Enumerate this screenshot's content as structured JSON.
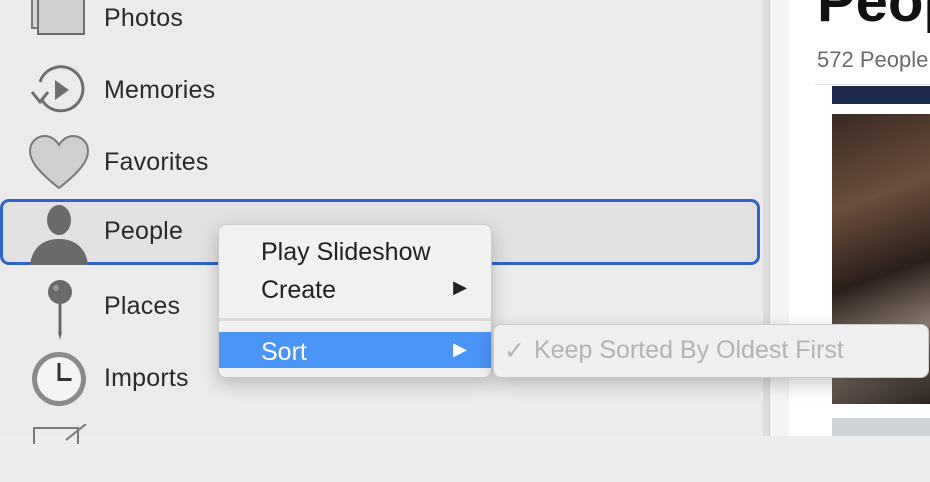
{
  "sidebar": {
    "items": [
      {
        "label": "Photos",
        "icon": "photos-icon"
      },
      {
        "label": "Memories",
        "icon": "memories-icon"
      },
      {
        "label": "Favorites",
        "icon": "heart-icon"
      },
      {
        "label": "People",
        "icon": "person-icon",
        "selected": true
      },
      {
        "label": "Places",
        "icon": "pin-icon"
      },
      {
        "label": "Imports",
        "icon": "clock-icon"
      }
    ]
  },
  "main": {
    "title": "People",
    "count": "572 People"
  },
  "context_menu": {
    "items": [
      {
        "label": "Play Slideshow"
      },
      {
        "label": "Create",
        "arrow": "▶"
      },
      {
        "label": "Sort",
        "arrow": "▶",
        "highlighted": true
      }
    ]
  },
  "submenu": {
    "check": "✓",
    "label": "Keep Sorted By Oldest First"
  },
  "colors": {
    "selection_border": "#2f63c9",
    "menu_highlight": "#4a94f5",
    "disabled_text": "#b3b3b3"
  }
}
